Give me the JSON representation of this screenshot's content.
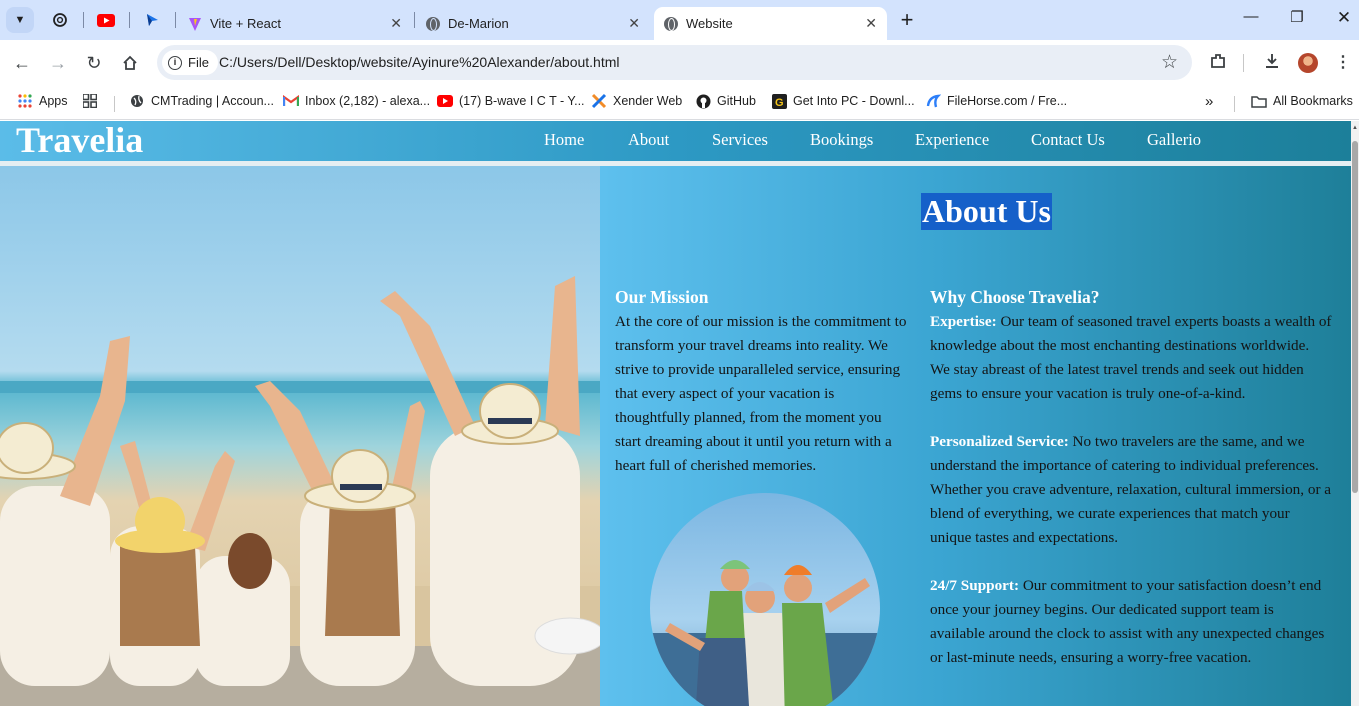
{
  "browser": {
    "tabs": [
      {
        "title": "Vite + React",
        "active": false
      },
      {
        "title": "De-Marion",
        "active": false
      },
      {
        "title": "Website",
        "active": true
      }
    ],
    "file_chip": "File",
    "url": "C:/Users/Dell/Desktop/website/Ayinure%20Alexander/about.html",
    "bookmarks": [
      {
        "label": "Apps",
        "icon": "apps-grid-icon"
      },
      {
        "label": "CMTrading | Accoun...",
        "icon": "globe-icon"
      },
      {
        "label": "Inbox (2,182) - alexa...",
        "icon": "gmail-icon"
      },
      {
        "label": "(17) B-wave I C T - Y...",
        "icon": "youtube-icon"
      },
      {
        "label": "Xender Web",
        "icon": "xender-icon"
      },
      {
        "label": "GitHub",
        "icon": "github-icon"
      },
      {
        "label": "Get Into PC - Downl...",
        "icon": "getintopc-icon"
      },
      {
        "label": "FileHorse.com / Fre...",
        "icon": "filehorse-icon"
      }
    ],
    "more_bookmarks": "»",
    "all_bookmarks": "All Bookmarks"
  },
  "site": {
    "brand": "Travelia",
    "nav": [
      "Home",
      "About",
      "Services",
      "Bookings",
      "Experience",
      "Contact Us",
      "Gallerio"
    ],
    "about_title": "About Us",
    "mission": {
      "heading": "Our Mission",
      "text": "At the core of our mission is the commitment to transform your travel dreams into reality. We strive to provide unparalleled service, ensuring that every aspect of your vacation is thoughtfully planned, from the moment you start dreaming about it until you return with a heart full of cherished memories."
    },
    "why": {
      "heading": "Why Choose Travelia?",
      "items": [
        {
          "lead": "Expertise:",
          "text": " Our team of seasoned travel experts boasts a wealth of knowledge about the most enchanting destinations worldwide. We stay abreast of the latest travel trends and seek out hidden gems to ensure your vacation is truly one-of-a-kind."
        },
        {
          "lead": "Personalized Service:",
          "text": " No two travelers are the same, and we understand the importance of catering to individual preferences. Whether you crave adventure, relaxation, cultural immersion, or a blend of everything, we curate experiences that match your unique tastes and expectations."
        },
        {
          "lead": "24/7 Support:",
          "text": " Our commitment to your satisfaction doesn’t end once your journey begins. Our dedicated support team is available around the clock to assist with any unexpected changes or last-minute needs, ensuring a worry-free vacation."
        }
      ]
    }
  },
  "colors": {
    "header_gradient": [
      "#5bbce8",
      "#1c7f9a"
    ],
    "title_highlight": "#1560c9",
    "tabstrip": "#d3e3fd"
  }
}
